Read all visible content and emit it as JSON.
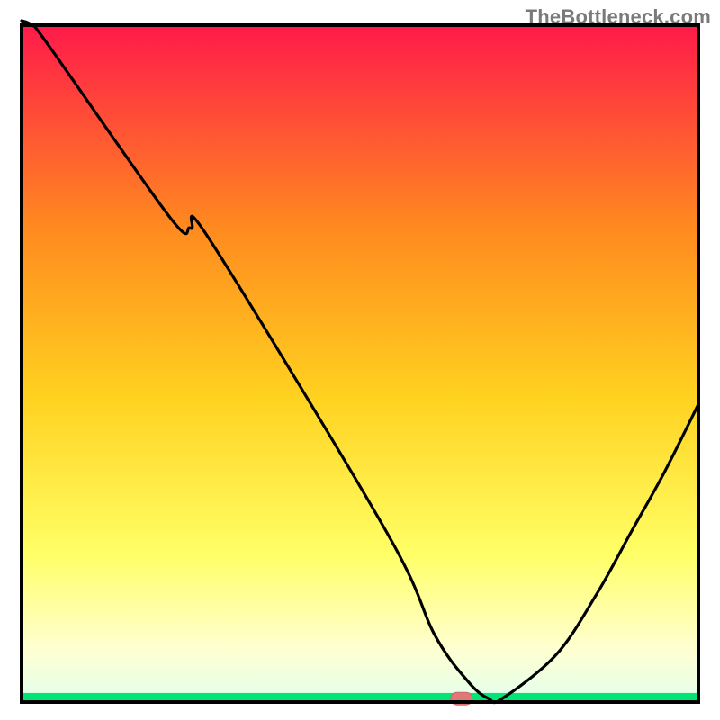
{
  "watermark": "TheBottleneck.com",
  "colors": {
    "gradient_top": "#ff1a4a",
    "gradient_mid1": "#ff8a1f",
    "gradient_mid2": "#ffd21f",
    "gradient_mid3": "#ffff66",
    "gradient_mid4": "#ffffd0",
    "gradient_bottom": "#00e676",
    "curve": "#000000",
    "marker_fill": "#e07878",
    "marker_stroke": "#c86868",
    "frame": "#000000"
  },
  "chart_data": {
    "type": "line",
    "title": "",
    "xlabel": "",
    "ylabel": "",
    "xlim": [
      0,
      100
    ],
    "ylim": [
      0,
      100
    ],
    "x": [
      0,
      1.5,
      4,
      22,
      25,
      28,
      54,
      61,
      66,
      69,
      71,
      79,
      85,
      90,
      95,
      100
    ],
    "values": [
      105,
      100,
      97,
      71.5,
      70,
      68,
      25,
      10,
      3,
      0.5,
      0.5,
      7,
      16,
      25,
      34,
      44
    ],
    "marker": {
      "x": 65,
      "y": 0.5
    }
  }
}
